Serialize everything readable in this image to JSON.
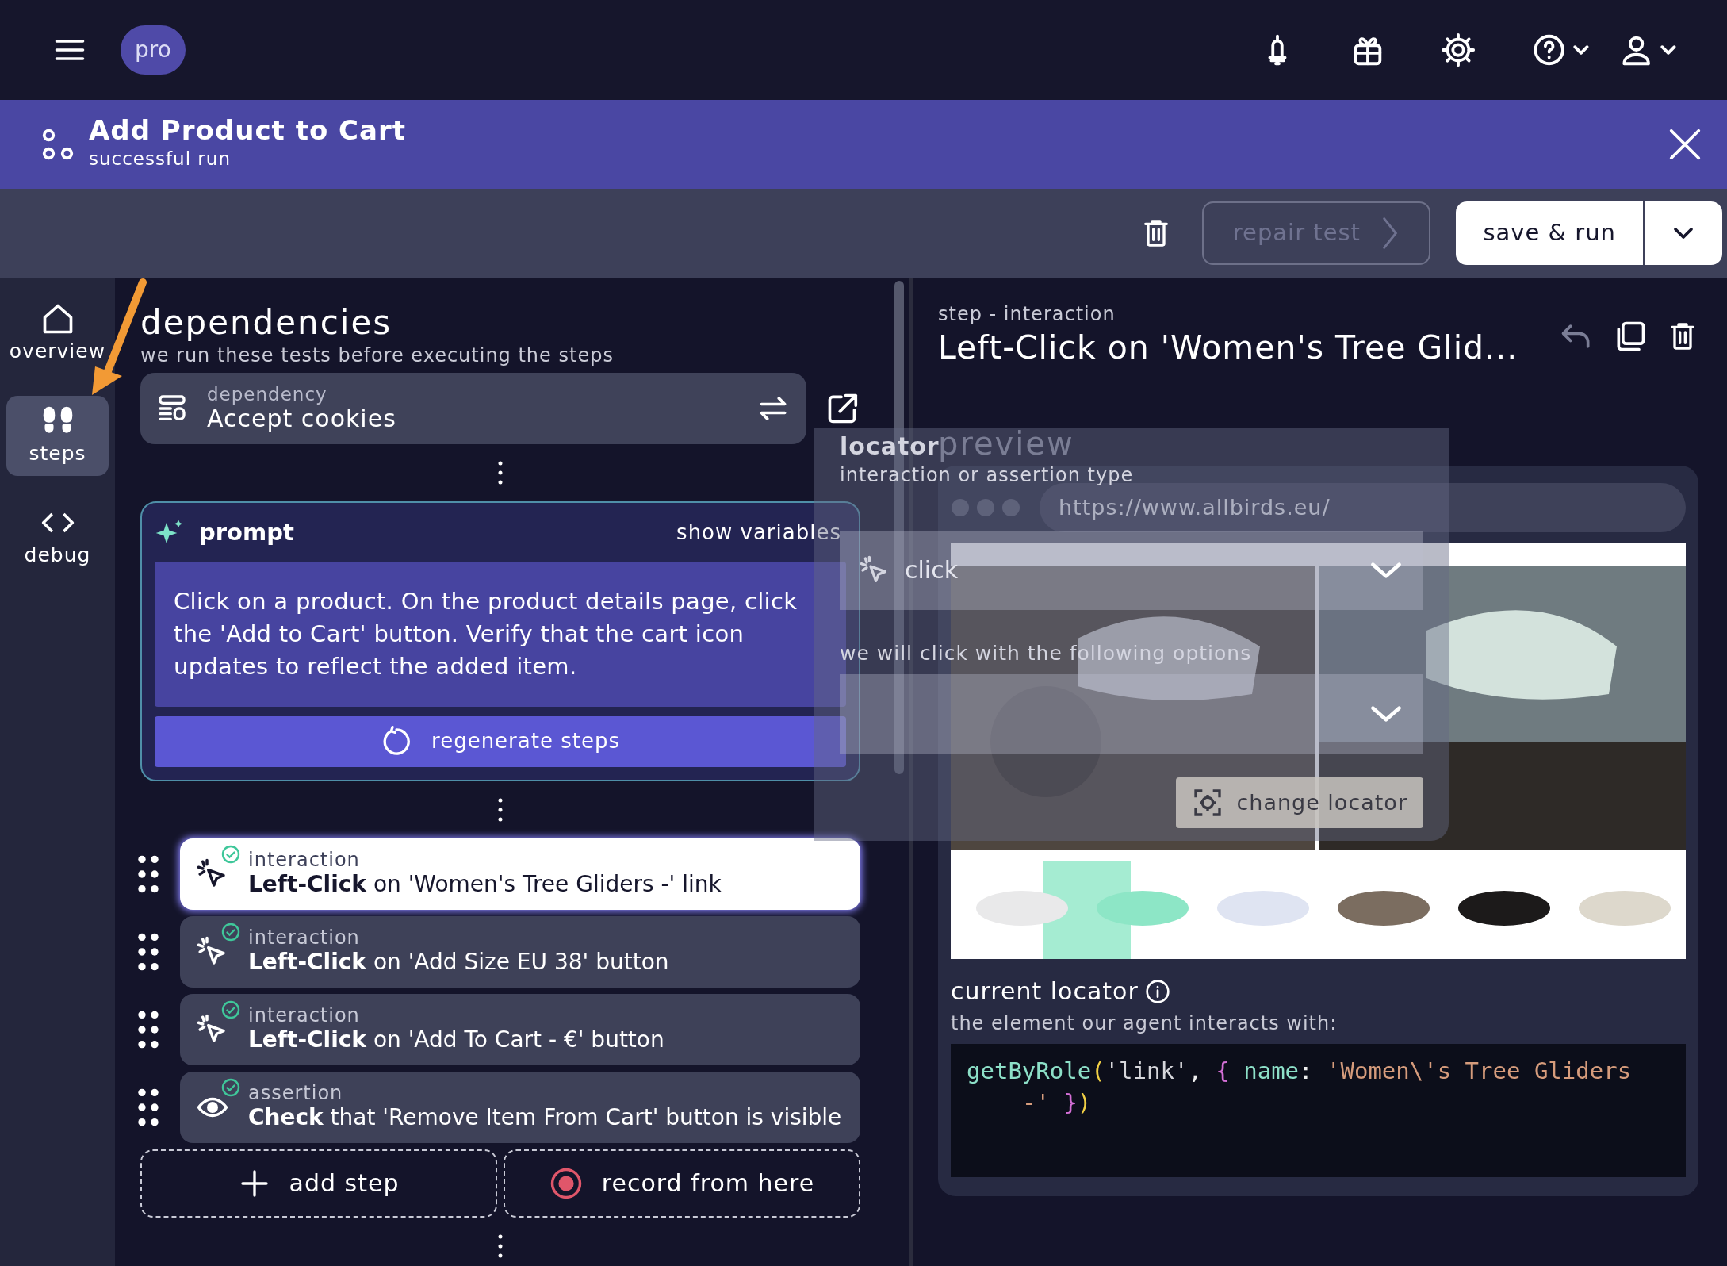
{
  "topbar": {
    "plan_badge": "pro"
  },
  "header": {
    "title": "Add Product to Cart",
    "subtitle": "successful run"
  },
  "toolbar": {
    "repair": {
      "label": "repair test",
      "disabled": true
    },
    "save": {
      "label": "save & run"
    }
  },
  "rail": [
    {
      "label": "overview",
      "kind": "home",
      "selected": false
    },
    {
      "label": "steps",
      "kind": "steps",
      "selected": true
    },
    {
      "label": "debug",
      "kind": "code",
      "selected": false
    }
  ],
  "dependencies": {
    "title": "dependencies",
    "subtitle": "we run these tests before executing the steps",
    "items": [
      {
        "label": "dependency",
        "name": "Accept cookies"
      }
    ]
  },
  "prompt": {
    "title": "prompt",
    "variables_link": "show variables",
    "text": "Click on a product. On the product details page, click the 'Add to Cart' button. Verify that the cart icon updates to reflect the added item.",
    "regenerate": "regenerate steps"
  },
  "steps": [
    {
      "kind": "click",
      "label": "interaction",
      "text": "**Left-Click** on 'Women's Tree Gliders -' link",
      "selected": true,
      "passed": true
    },
    {
      "kind": "click",
      "label": "interaction",
      "text": "**Left-Click** on 'Add Size EU 38' button",
      "selected": false,
      "passed": true
    },
    {
      "kind": "click",
      "label": "interaction",
      "text": "**Left-Click** on 'Add To Cart - €' button",
      "selected": false,
      "passed": true
    },
    {
      "kind": "check",
      "label": "assertion",
      "text": "**Check** that 'Remove Item From Cart' button is visible",
      "selected": false,
      "passed": true
    }
  ],
  "step_actions": [
    {
      "kind": "add",
      "label": "add step"
    },
    {
      "kind": "record",
      "label": "record from here"
    }
  ],
  "detail": {
    "overline": "step - interaction",
    "title": "Left-Click on 'Women's Tree Glid...",
    "preview_title": "preview",
    "url": "https://www.allbirds.eu/",
    "preview": {
      "kind": "picture"
    },
    "locator_title": "current locator",
    "locator_subtitle": "the element our agent interacts with:",
    "code": [
      [
        {
          "text": "getByRole",
          "kind": "fn"
        },
        {
          "text": "(",
          "kind": "paren"
        },
        {
          "text": "'link'",
          "kind": "plain"
        },
        {
          "text": ", ",
          "kind": "punct"
        },
        {
          "text": "{",
          "kind": "brace"
        },
        {
          "text": " name",
          "kind": "prop"
        },
        {
          "text": ": ",
          "kind": "punct"
        },
        {
          "text": "'Women\\'s Tree Gliders",
          "kind": "str"
        }
      ],
      [
        {
          "text": "-'",
          "kind": "str"
        },
        {
          "text": " }",
          "kind": "brace"
        },
        {
          "text": ")",
          "kind": "paren"
        }
      ]
    ]
  },
  "locator_panel": {
    "title": "locator",
    "type_label": "interaction or assertion type",
    "type_value": "click",
    "options_label": "we will click with the following options",
    "change_button": "change locator"
  }
}
